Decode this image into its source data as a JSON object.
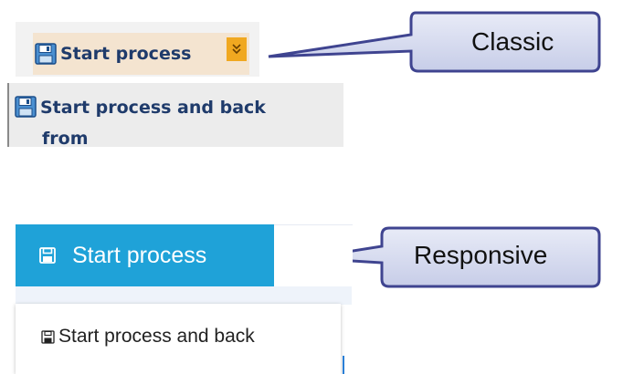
{
  "classic": {
    "button_label": "Start process",
    "caret_icon": "double-chevron-down-icon",
    "menu_item_label": "Start process and back",
    "menu_item_label_overflow": "from",
    "callout_label": "Classic"
  },
  "responsive": {
    "button_label": "Start process",
    "menu_item_label": "Start process and back",
    "callout_label": "Responsive"
  },
  "colors": {
    "classic_button_bg": "#f4e4d0",
    "classic_text": "#1f3b6b",
    "classic_caret_bg": "#f0a820",
    "responsive_button_bg": "#1fa2d8",
    "callout_fill": "#d9def1",
    "callout_stroke": "#3f4490"
  }
}
